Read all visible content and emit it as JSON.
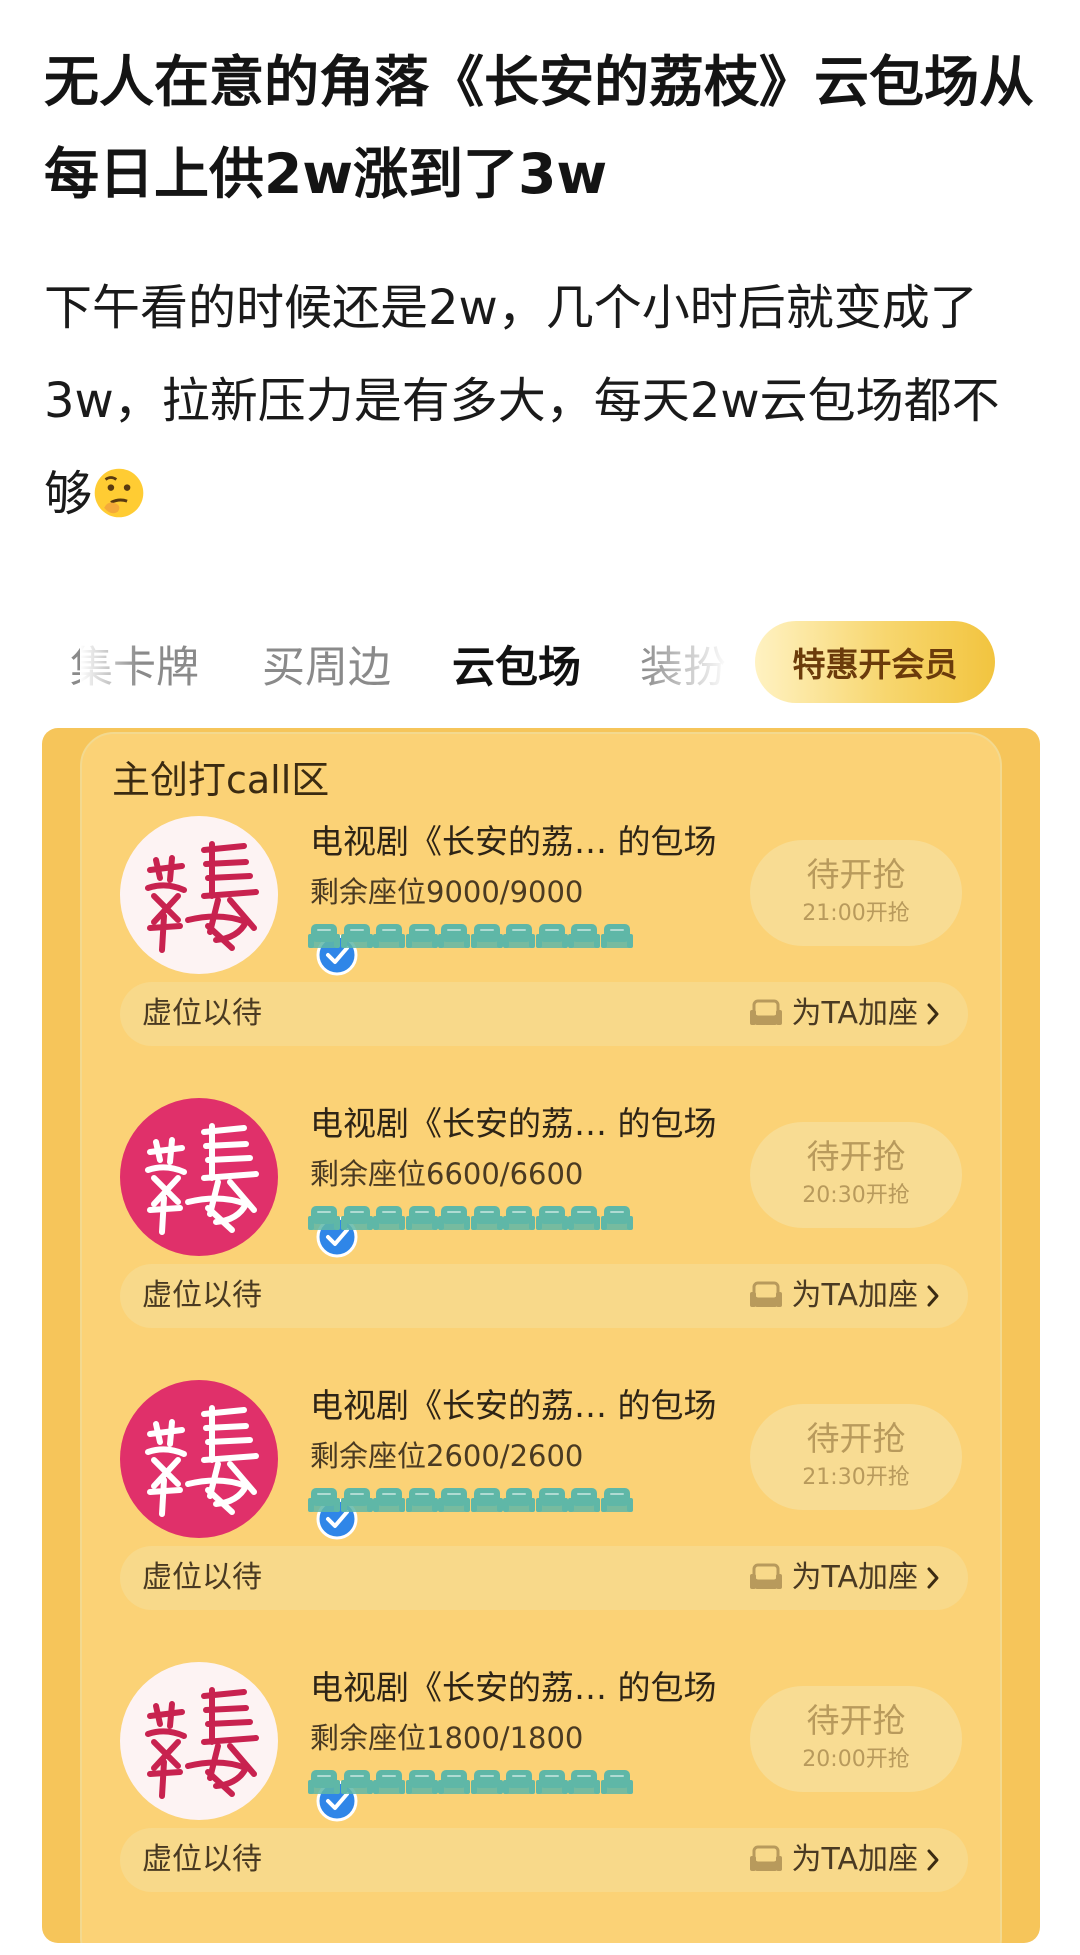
{
  "post": {
    "title": "无人在意的角落《长安的荔枝》云包场从每日上供2w涨到了3w",
    "body": "下午看的时候还是2w，几个小时后就变成了3w，拉新压力是有多大，每天2w云包场都不够",
    "emoji": "thinking-face-emoji"
  },
  "tabs": {
    "items": [
      "集卡牌",
      "买周边",
      "云包场",
      "装扮"
    ],
    "active": "云包场",
    "vip_button": "特惠开会员"
  },
  "panel": {
    "title": "主创打call区",
    "cards": [
      {
        "title": "电视剧《长安的荔… 的包场",
        "seats": "剩余座位9000/9000",
        "grab": "待开抢",
        "time": "21:00开抢",
        "footer": "虚位以待",
        "action": "为TA加座",
        "avatar_bg": "#fdf3f3"
      },
      {
        "title": "电视剧《长安的荔… 的包场",
        "seats": "剩余座位6600/6600",
        "grab": "待开抢",
        "time": "20:30开抢",
        "footer": "虚位以待",
        "action": "为TA加座",
        "avatar_bg": "#e0306a"
      },
      {
        "title": "电视剧《长安的荔… 的包场",
        "seats": "剩余座位2600/2600",
        "grab": "待开抢",
        "time": "21:30开抢",
        "footer": "虚位以待",
        "action": "为TA加座",
        "avatar_bg": "#e0306a"
      },
      {
        "title": "电视剧《长安的荔… 的包场",
        "seats": "剩余座位1800/1800",
        "grab": "待开抢",
        "time": "20:00开抢",
        "footer": "虚位以待",
        "action": "为TA加座",
        "avatar_bg": "#fdf3f3"
      }
    ],
    "seat_icons_per_card": 10
  },
  "colors": {
    "panel": "#f6c55a",
    "seat": "#5fb7a7",
    "verified": "#2f86e8",
    "logo_red": "#c8224f",
    "grab_text": "#b89a5c"
  }
}
